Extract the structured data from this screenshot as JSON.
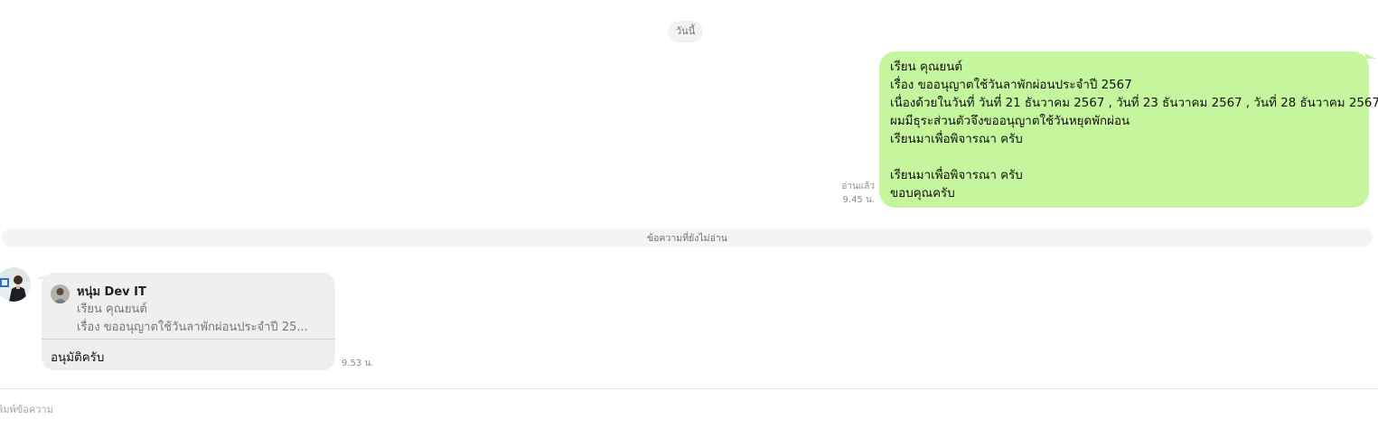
{
  "date_chip": "วันนี้",
  "outgoing_message": {
    "lines": [
      "เรียน คุณยนต์",
      "เรื่อง ขออนุญาตใช้วันลาพักผ่อนประจำปี 2567",
      "เนื่องด้วยในวันที่ วันที่ 21 ธันวาคม 2567  , วันที่ 23 ธันวาคม 2567 , วันที่ 28 ธันวาคม 2567",
      "ผมมีธุระส่วนตัวจึงขออนุญาตใช้วันหยุดพักผ่อน",
      "เรียนมาเพื่อพิจารณา ครับ",
      "",
      "เรียนมาเพื่อพิจารณา ครับ",
      "ขอบคุณครับ"
    ],
    "read_status": "อ่านแล้ว",
    "time": "9.45 น.",
    "color": "#c5f59c"
  },
  "unread_divider": "ข้อความที่ยังไม่อ่าน",
  "incoming_message": {
    "reply_to": {
      "sender_name": "หนุ่ม Dev IT",
      "preview_line1": "เรียน คุณยนต์",
      "preview_line2": "เรื่อง ขออนุญาตใช้วันลาพักผ่อนประจำปี 25..."
    },
    "text": "อนุมัติครับ",
    "time": "9.53 น.",
    "avatar_icon": "user-avatar",
    "color": "#efefef"
  },
  "composer": {
    "placeholder": "พิมพ์ข้อความ",
    "value": ""
  }
}
